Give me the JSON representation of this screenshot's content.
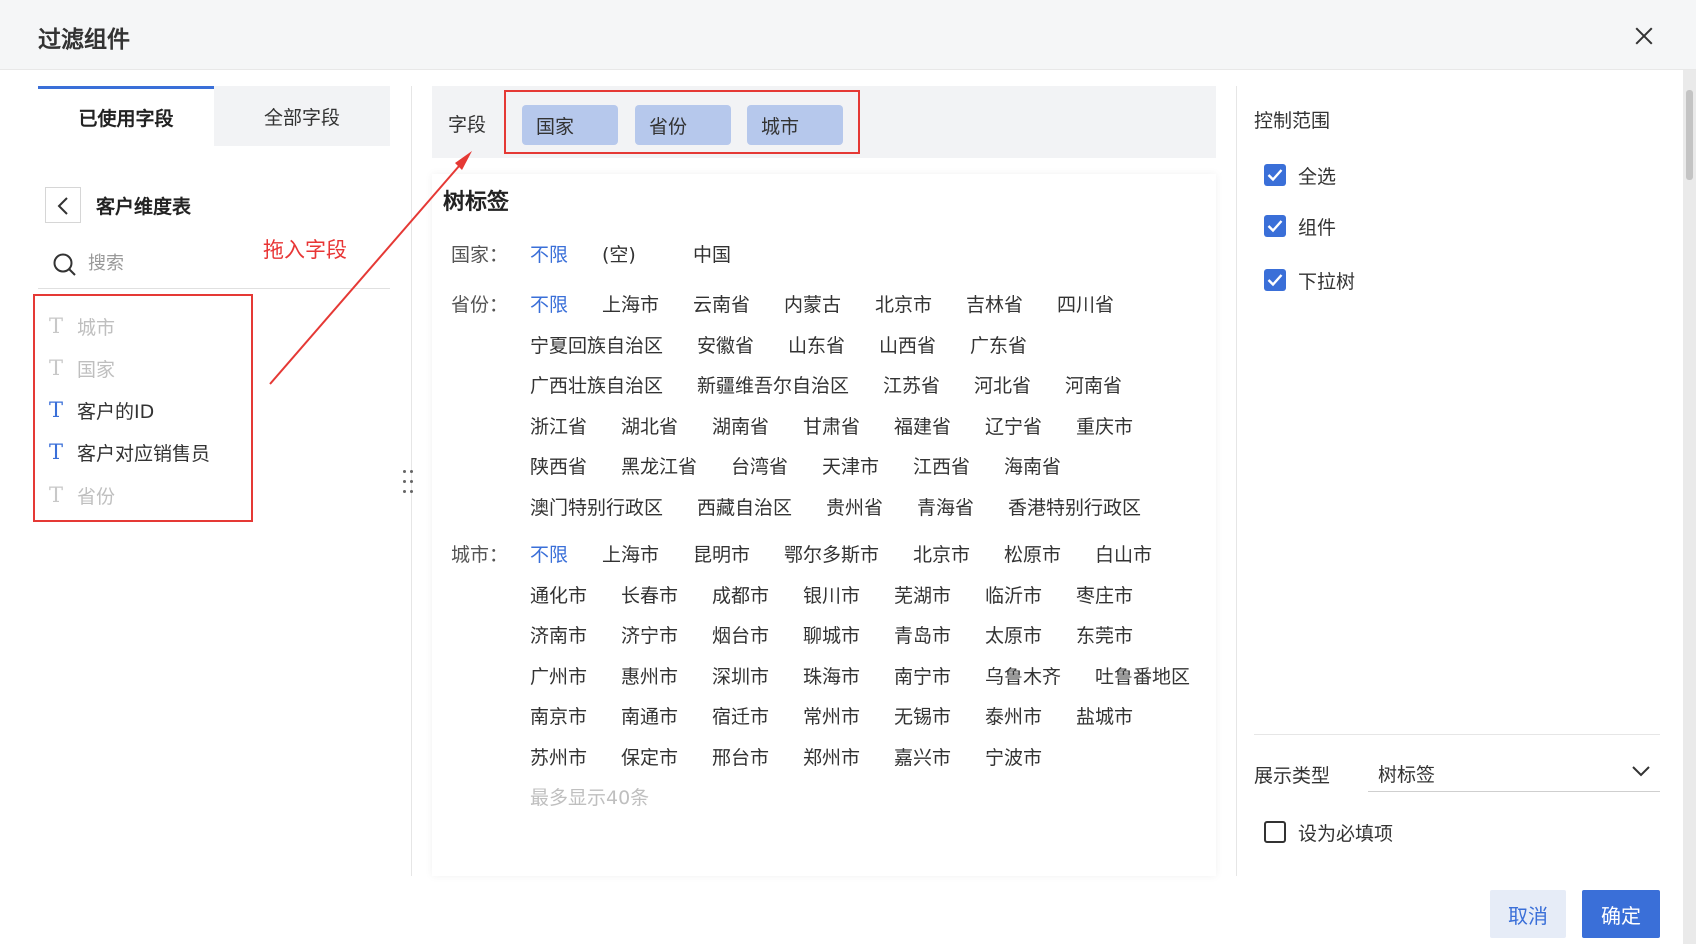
{
  "dialog": {
    "title": "过滤组件"
  },
  "left_panel": {
    "tabs": [
      {
        "label": "已使用字段",
        "active": true
      },
      {
        "label": "全部字段",
        "active": false
      }
    ],
    "table_name": "客户维度表",
    "search_placeholder": "搜索",
    "drag_hint": "拖入字段",
    "fields": [
      {
        "label": "城市",
        "type_icon": "T",
        "enabled": false
      },
      {
        "label": "国家",
        "type_icon": "T",
        "enabled": false
      },
      {
        "label": "客户的ID",
        "type_icon": "T",
        "enabled": true
      },
      {
        "label": "客户对应销售员",
        "type_icon": "T",
        "enabled": true
      },
      {
        "label": "省份",
        "type_icon": "T",
        "enabled": false
      }
    ]
  },
  "middle_panel": {
    "field_bar_label": "字段",
    "chips": [
      "国家",
      "省份",
      "城市"
    ],
    "preview_title": "树标签",
    "rows": [
      {
        "label": "国家：",
        "options": [
          "不限",
          "(空)",
          "中国"
        ]
      },
      {
        "label": "省份：",
        "options": [
          "不限",
          "上海市",
          "云南省",
          "内蒙古",
          "北京市",
          "吉林省",
          "四川省",
          "宁夏回族自治区",
          "安徽省",
          "山东省",
          "山西省",
          "广东省",
          "广西壮族自治区",
          "新疆维吾尔自治区",
          "江苏省",
          "河北省",
          "河南省",
          "浙江省",
          "湖北省",
          "湖南省",
          "甘肃省",
          "福建省",
          "辽宁省",
          "重庆市",
          "陕西省",
          "黑龙江省",
          "台湾省",
          "天津市",
          "江西省",
          "海南省",
          "澳门特别行政区",
          "西藏自治区",
          "贵州省",
          "青海省",
          "香港特别行政区"
        ]
      },
      {
        "label": "城市：",
        "options": [
          "不限",
          "上海市",
          "昆明市",
          "鄂尔多斯市",
          "北京市",
          "松原市",
          "白山市",
          "通化市",
          "长春市",
          "成都市",
          "银川市",
          "芜湖市",
          "临沂市",
          "枣庄市",
          "济南市",
          "济宁市",
          "烟台市",
          "聊城市",
          "青岛市",
          "太原市",
          "东莞市",
          "广州市",
          "惠州市",
          "深圳市",
          "珠海市",
          "南宁市",
          "乌鲁木齐",
          "吐鲁番地区",
          "南京市",
          "南通市",
          "宿迁市",
          "常州市",
          "无锡市",
          "泰州市",
          "盐城市",
          "苏州市",
          "保定市",
          "邢台市",
          "郑州市",
          "嘉兴市",
          "宁波市"
        ],
        "more_note": "最多显示40条"
      }
    ]
  },
  "right_panel": {
    "control_scope_title": "控制范围",
    "checkboxes": [
      {
        "label": "全选",
        "checked": true
      },
      {
        "label": "组件",
        "checked": true
      },
      {
        "label": "下拉树",
        "checked": true
      }
    ],
    "display_type_label": "展示类型",
    "display_type_value": "树标签",
    "required_label": "设为必填项",
    "required_checked": false
  },
  "footer": {
    "cancel_label": "取消",
    "ok_label": "确定"
  },
  "colors": {
    "accent": "#3a6fd8",
    "chip_bg": "#b6c8ec",
    "annotation_red": "#e53935"
  },
  "icons": [
    "close-icon",
    "chevron-left-icon",
    "search-icon",
    "text-field-icon",
    "grip-icon",
    "check-icon",
    "chevron-down-icon",
    "arrow-annotation-icon"
  ]
}
